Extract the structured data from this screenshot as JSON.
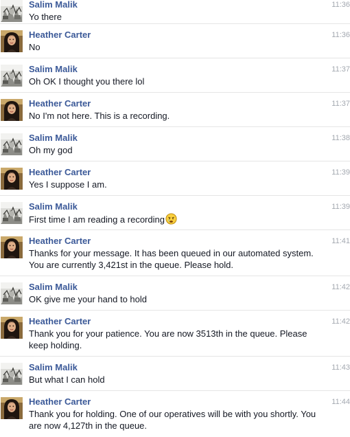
{
  "colors": {
    "sender": "#3b5998",
    "text": "#141823",
    "time": "#a3a8b0",
    "divider": "#e5e5e5"
  },
  "messages": [
    {
      "sender": "Salim Malik",
      "text": "Yo there",
      "time": "11:36",
      "avatar": "salim-avatar"
    },
    {
      "sender": "Heather Carter",
      "text": "No",
      "time": "11:36",
      "avatar": "heather-avatar"
    },
    {
      "sender": "Salim Malik",
      "text": "Oh OK I thought you there lol",
      "time": "11:37",
      "avatar": "salim-avatar"
    },
    {
      "sender": "Heather Carter",
      "text": "No I'm not here. This is a recording.",
      "time": "11:37",
      "avatar": "heather-avatar"
    },
    {
      "sender": "Salim Malik",
      "text": "Oh my god",
      "time": "11:38",
      "avatar": "salim-avatar"
    },
    {
      "sender": "Heather Carter",
      "text": "Yes I suppose I am.",
      "time": "11:39",
      "avatar": "heather-avatar"
    },
    {
      "sender": "Salim Malik",
      "text": "First time I am reading a recording",
      "time": "11:39",
      "avatar": "salim-avatar",
      "emoji": "crying-face-emoji"
    },
    {
      "sender": "Heather Carter",
      "text": "Thanks for your message. It has been queued in our automated system. You are currently 3,421st in the queue. Please hold.",
      "time": "11:41",
      "avatar": "heather-avatar"
    },
    {
      "sender": "Salim Malik",
      "text": "OK give me your hand to hold",
      "time": "11:42",
      "avatar": "salim-avatar"
    },
    {
      "sender": "Heather Carter",
      "text": "Thank you for your patience. You are now 3513th in the queue. Please keep holding.",
      "time": "11:42",
      "avatar": "heather-avatar"
    },
    {
      "sender": "Salim Malik",
      "text": "But what I can hold",
      "time": "11:43",
      "avatar": "salim-avatar"
    },
    {
      "sender": "Heather Carter",
      "text": "Thank you for holding. One of our operatives will be with you shortly. You are now 4,127th in the queue.",
      "time": "11:44",
      "avatar": "heather-avatar"
    }
  ]
}
